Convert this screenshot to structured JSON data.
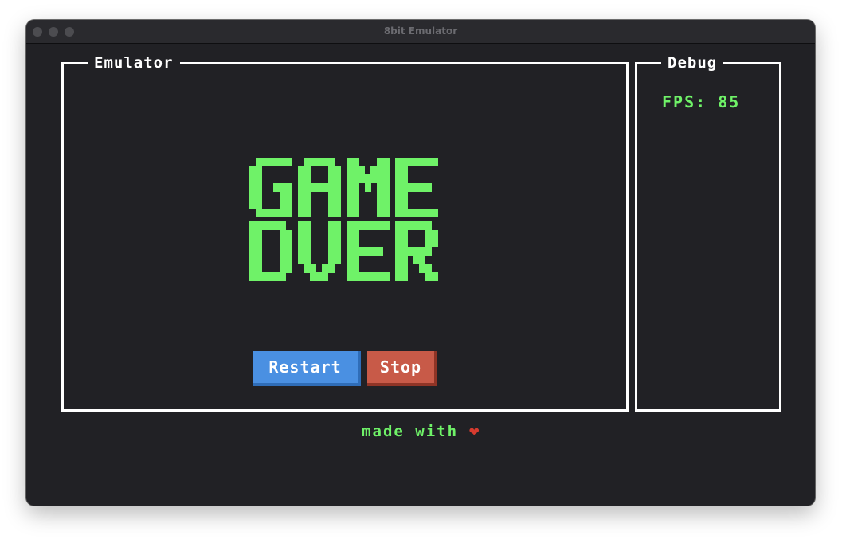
{
  "window": {
    "title": "8bit Emulator"
  },
  "emulator_panel": {
    "legend": "Emulator",
    "screen_text": [
      "GAME",
      "OVER"
    ],
    "screen_color": "#6ff268",
    "buttons": {
      "restart_label": "Restart",
      "stop_label": "Stop"
    }
  },
  "debug_panel": {
    "legend": "Debug",
    "fps_label": "FPS:",
    "fps_value": "85"
  },
  "footer": {
    "text": "made with",
    "heart_icon": "heart-icon",
    "heart_glyph": "❤"
  },
  "colors": {
    "background": "#212125",
    "accent_green": "#6ff268",
    "restart_button": "#4a90e2",
    "stop_button": "#c85a48",
    "border": "#ffffff"
  }
}
